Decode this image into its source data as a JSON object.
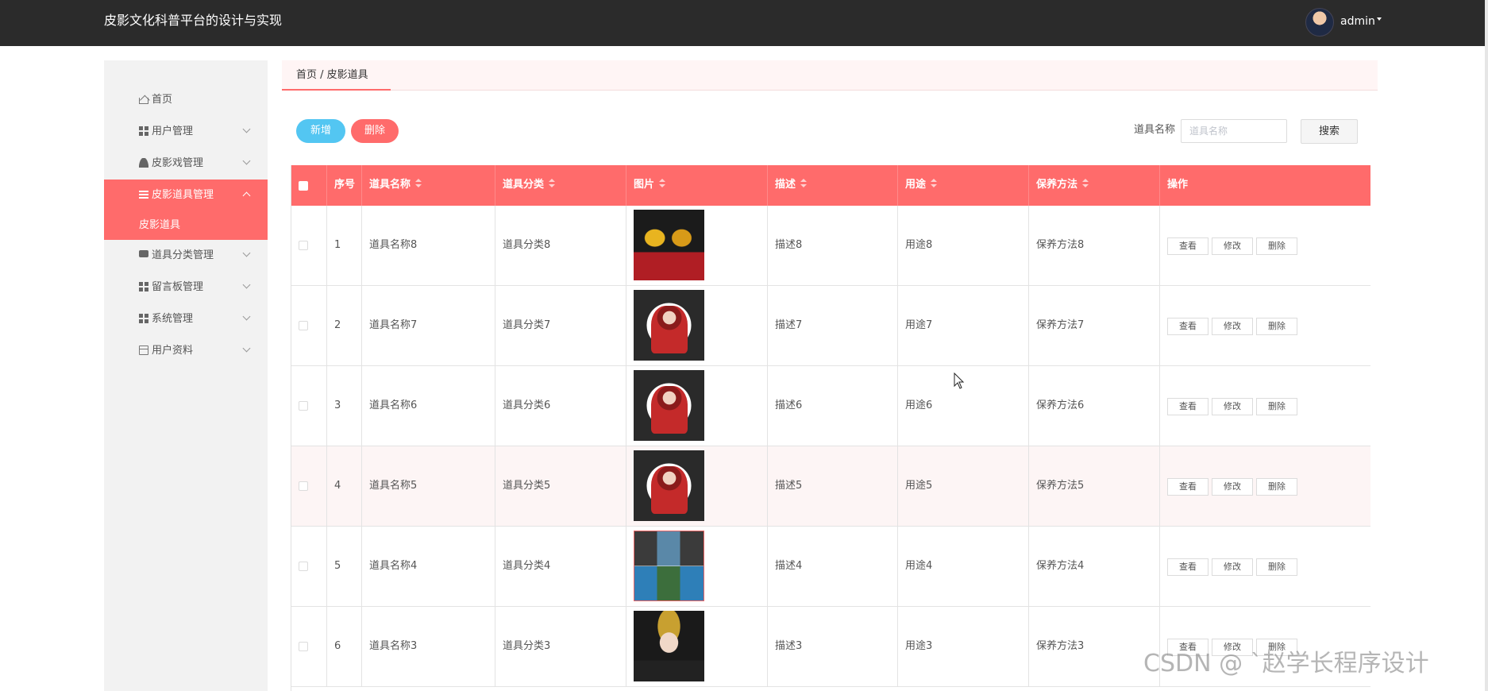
{
  "header": {
    "title": "皮影文化科普平台的设计与实现",
    "user": "admin"
  },
  "sidebar": {
    "items": [
      {
        "label": "首页",
        "icon": "home-icon"
      },
      {
        "label": "用户管理",
        "icon": "grid-icon"
      },
      {
        "label": "皮影戏管理",
        "icon": "user-icon"
      },
      {
        "label": "皮影道具管理",
        "icon": "list-icon",
        "active": true
      },
      {
        "label": "道具分类管理",
        "icon": "chat-icon"
      },
      {
        "label": "留言板管理",
        "icon": "grid-icon"
      },
      {
        "label": "系统管理",
        "icon": "grid-icon"
      },
      {
        "label": "用户资料",
        "icon": "card-icon"
      }
    ],
    "submenu_active": "皮影道具"
  },
  "breadcrumb": "首页 / 皮影道具",
  "toolbar": {
    "add_label": "新增",
    "delete_label": "删除",
    "search_label": "道具名称",
    "search_placeholder": "道具名称",
    "search_button": "搜索"
  },
  "table": {
    "columns": [
      "序号",
      "道具名称",
      "道具分类",
      "图片",
      "描述",
      "用途",
      "保养方法",
      "操作"
    ],
    "rows": [
      {
        "no": "1",
        "name": "道具名称8",
        "category": "道具分类8",
        "image": "costume-gold-red",
        "desc": "描述8",
        "use": "用途8",
        "care": "保养方法8"
      },
      {
        "no": "2",
        "name": "道具名称7",
        "category": "道具分类7",
        "image": "opera-performer",
        "desc": "描述7",
        "use": "用途7",
        "care": "保养方法7"
      },
      {
        "no": "3",
        "name": "道具名称6",
        "category": "道具分类6",
        "image": "opera-performer",
        "desc": "描述6",
        "use": "用途6",
        "care": "保养方法6"
      },
      {
        "no": "4",
        "name": "道具名称5",
        "category": "道具分类5",
        "image": "opera-performer",
        "desc": "描述5",
        "use": "用途5",
        "care": "保养方法5"
      },
      {
        "no": "5",
        "name": "道具名称4",
        "category": "道具分类4",
        "image": "costume-grid",
        "desc": "描述4",
        "use": "用途4",
        "care": "保养方法4"
      },
      {
        "no": "6",
        "name": "道具名称3",
        "category": "道具分类3",
        "image": "headdress-portrait",
        "desc": "描述3",
        "use": "用途3",
        "care": "保养方法3"
      }
    ],
    "actions": [
      "查看",
      "修改",
      "删除"
    ]
  },
  "watermark": "CSDN @  `赵学长程序设计",
  "colors": {
    "accent": "#ff6b6b",
    "add": "#53c6f2",
    "topbar": "#2b2b2b"
  }
}
